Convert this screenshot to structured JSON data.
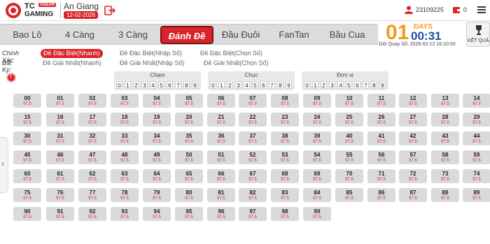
{
  "header": {
    "logo": {
      "tc": "TC",
      "asean": "ASEAN",
      "gaming": "GAMING"
    },
    "region_name": "An Giang",
    "region_date": "12-02-2026",
    "user_id": "23109225",
    "balance": "0",
    "icons": {
      "logout": "logout-icon",
      "user": "user-icon",
      "balance": "wallet-icon",
      "menu": "menu-icon"
    }
  },
  "tabs": [
    "Bao Lô",
    "4 Càng",
    "3 Càng",
    "Đánh Đề",
    "Đầu Đuôi",
    "FanTan",
    "Bầu Cua"
  ],
  "active_tab": "Đánh Đề",
  "timer": {
    "days": "01",
    "days_label": "DAYS",
    "clock": "00:31",
    "draw_label": "Giờ Quay Số: 2026-02-12 16:10:00",
    "result_label": "KẾT QUẢ"
  },
  "bet_types": {
    "row1": {
      "label": "Chính Xác:",
      "options": [
        "Đề Đặc Biệt(Nhanh)",
        "Đề Đặc Biệt(Nhập Số)",
        "Đề Đặc Biệt(Chọn Số)"
      ]
    },
    "row2": {
      "label": "Bất Kỳ:",
      "options": [
        "Đề Giải Nhất(Nhanh)",
        "Đề Giải Nhất(Nhập Số)",
        "Đề Giải Nhất(Chọn Số)"
      ]
    },
    "active": "Đề Đặc Biệt(Nhanh)"
  },
  "filters": [
    {
      "title": "Chạm",
      "digits": [
        "0",
        "1",
        "2",
        "3",
        "4",
        "5",
        "6",
        "7",
        "8",
        "9"
      ]
    },
    {
      "title": "Chục",
      "digits": [
        "0",
        "1",
        "2",
        "3",
        "4",
        "5",
        "6",
        "7",
        "8",
        "9"
      ]
    },
    {
      "title": "Đơn vị",
      "digits": [
        "0",
        "1",
        "2",
        "3",
        "4",
        "5",
        "6",
        "7",
        "8",
        "9"
      ]
    }
  ],
  "odds": "97.5",
  "numbers": [
    "00",
    "01",
    "02",
    "03",
    "04",
    "05",
    "06",
    "07",
    "08",
    "09",
    "10",
    "11",
    "12",
    "13",
    "14",
    "15",
    "16",
    "17",
    "18",
    "19",
    "20",
    "21",
    "22",
    "23",
    "24",
    "25",
    "26",
    "27",
    "28",
    "29",
    "30",
    "31",
    "32",
    "33",
    "34",
    "35",
    "36",
    "37",
    "38",
    "39",
    "40",
    "41",
    "42",
    "43",
    "44",
    "45",
    "46",
    "47",
    "48",
    "49",
    "50",
    "51",
    "52",
    "53",
    "54",
    "55",
    "56",
    "57",
    "58",
    "59",
    "60",
    "61",
    "62",
    "63",
    "64",
    "65",
    "66",
    "67",
    "68",
    "69",
    "70",
    "71",
    "72",
    "73",
    "74",
    "75",
    "76",
    "77",
    "78",
    "79",
    "80",
    "81",
    "82",
    "83",
    "84",
    "85",
    "86",
    "87",
    "88",
    "89",
    "90",
    "91",
    "92",
    "93",
    "94",
    "95",
    "96",
    "97",
    "98",
    "99"
  ],
  "colors": {
    "accent": "#d9252a",
    "timer_orange": "#f49b1a",
    "timer_blue": "#1c4fa3"
  }
}
